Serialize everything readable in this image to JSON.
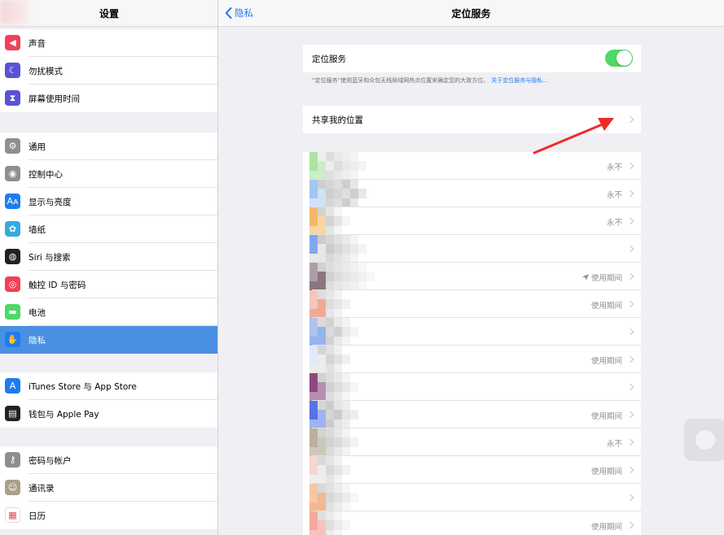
{
  "sidebar": {
    "title": "设置",
    "groups": [
      [
        {
          "label": "声音",
          "icon": "speaker-icon",
          "color": "#f2405a"
        },
        {
          "label": "勿扰模式",
          "icon": "moon-icon",
          "color": "#5a52d6"
        },
        {
          "label": "屏幕使用时间",
          "icon": "hourglass-icon",
          "color": "#5a52d6"
        }
      ],
      [
        {
          "label": "通用",
          "icon": "gear-icon",
          "color": "#8e8e93"
        },
        {
          "label": "控制中心",
          "icon": "toggles-icon",
          "color": "#8e8e93"
        },
        {
          "label": "显示与亮度",
          "icon": "text-size-icon",
          "color": "#1e7cf2"
        },
        {
          "label": "墙纸",
          "icon": "flower-icon",
          "color": "#36aadc"
        },
        {
          "label": "Siri 与搜索",
          "icon": "siri-icon",
          "color": "#222"
        },
        {
          "label": "触控 ID 与密码",
          "icon": "fingerprint-icon",
          "color": "#f2405a"
        },
        {
          "label": "电池",
          "icon": "battery-icon",
          "color": "#4cd964"
        },
        {
          "label": "隐私",
          "icon": "hand-icon",
          "color": "#1e7cf2",
          "selected": true
        }
      ],
      [
        {
          "label": "iTunes Store 与 App Store",
          "icon": "app-store-icon",
          "color": "#1e7cf2"
        },
        {
          "label": "钱包与 Apple Pay",
          "icon": "wallet-icon",
          "color": "#222"
        }
      ],
      [
        {
          "label": "密码与帐户",
          "icon": "key-icon",
          "color": "#8e8e93"
        },
        {
          "label": "通讯录",
          "icon": "contacts-icon",
          "color": "#a8a08a"
        },
        {
          "label": "日历",
          "icon": "calendar-icon",
          "color": "#ffffff"
        }
      ]
    ]
  },
  "header": {
    "back_label": "隐私",
    "title": "定位服务"
  },
  "location": {
    "label": "定位服务",
    "enabled": true,
    "footnote": "“定位服务”使用蓝牙和众包无线局域网热点位置来确定您的大致方位。",
    "footnote_link": "关于定位服务与隐私…"
  },
  "share": {
    "label": "共享我的位置"
  },
  "apps": [
    {
      "status": "永不",
      "arrow": false,
      "tiles": [
        "#a6e39a",
        "#c8eec2",
        "#eee",
        "#ddd",
        "#e8e8e8",
        "#eee",
        "#f4f4f4",
        "#fff",
        "#fff"
      ]
    },
    {
      "status": "永不",
      "arrow": false,
      "tiles": [
        "#9cc5f3",
        "#cfe0f7",
        "#ccc",
        "#d4d4d4",
        "#ddd",
        "#ccc",
        "#e6e6e6",
        "#fff",
        "#fff"
      ]
    },
    {
      "status": "永不",
      "arrow": false,
      "tiles": [
        "#f3b561",
        "#f9d39c",
        "#d0d0d0",
        "#e3e3e3",
        "#f5f5f5",
        "#fff",
        "#fff",
        "#fff",
        "#fff"
      ]
    },
    {
      "status": "",
      "arrow": false,
      "tiles": [
        "#7aa3f0",
        "#e6e6e6",
        "#c9c9c9",
        "#d5d5d5",
        "#e0e0e0",
        "#e9e9e9",
        "#f4f4f4",
        "#fff",
        "#fff"
      ]
    },
    {
      "status": "使用期间",
      "arrow": true,
      "tiles": [
        "#a79aa4",
        "#856f7b",
        "#cfcfcf",
        "#dcdcdc",
        "#e4e4e4",
        "#eaeaea",
        "#f0f0f0",
        "#f7f7f7",
        "#fff"
      ]
    },
    {
      "status": "使用期间",
      "arrow": false,
      "tiles": [
        "#f7c2b6",
        "#f1a58f",
        "#dcdcdc",
        "#e5e5e5",
        "#f2f2f2",
        "#fff",
        "#fff",
        "#fff",
        "#fff"
      ]
    },
    {
      "status": "",
      "arrow": false,
      "tiles": [
        "#a7c1f0",
        "#8fb1ee",
        "#d9d9d9",
        "#cfcfcf",
        "#e8e8e8",
        "#f3f3f3",
        "#fff",
        "#fff",
        "#fff"
      ]
    },
    {
      "status": "使用期间",
      "arrow": false,
      "tiles": [
        "#dfe9f8",
        "#ececec",
        "#d2d2d2",
        "#e0e0e0",
        "#f0f0f0",
        "#fff",
        "#fff",
        "#fff",
        "#fff"
      ]
    },
    {
      "status": "",
      "arrow": false,
      "tiles": [
        "#8a3f79",
        "#b589aa",
        "#cfcfcf",
        "#dcdcdc",
        "#e7e7e7",
        "#f5f5f5",
        "#fff",
        "#fff",
        "#fff"
      ]
    },
    {
      "status": "使用期间",
      "arrow": false,
      "tiles": [
        "#4f6be6",
        "#9aaef2",
        "#d4d4d4",
        "#c9c9c9",
        "#e4e4e4",
        "#eeeeee",
        "#fff",
        "#fff",
        "#fff"
      ]
    },
    {
      "status": "永不",
      "arrow": false,
      "tiles": [
        "#b6ac9a",
        "#cbc5b8",
        "#d0d0d0",
        "#d9d9d9",
        "#e6e6e6",
        "#f3f3f3",
        "#fff",
        "#fff",
        "#fff"
      ]
    },
    {
      "status": "使用期间",
      "arrow": false,
      "tiles": [
        "#f7d3cf",
        "#eeeeee",
        "#d8d8d8",
        "#e4e4e4",
        "#f2f2f2",
        "#fff",
        "#fff",
        "#fff",
        "#fff"
      ]
    },
    {
      "status": "",
      "arrow": false,
      "tiles": [
        "#f6c59c",
        "#f3b48e",
        "#d7d7d7",
        "#e0e0e0",
        "#ececec",
        "#f6f6f6",
        "#fff",
        "#fff",
        "#fff"
      ]
    },
    {
      "status": "使用期间",
      "arrow": false,
      "tiles": [
        "#f2a59a",
        "#f6c0b6",
        "#dedede",
        "#eaeaea",
        "#f5f5f5",
        "#fff",
        "#fff",
        "#fff",
        "#fff"
      ]
    }
  ]
}
